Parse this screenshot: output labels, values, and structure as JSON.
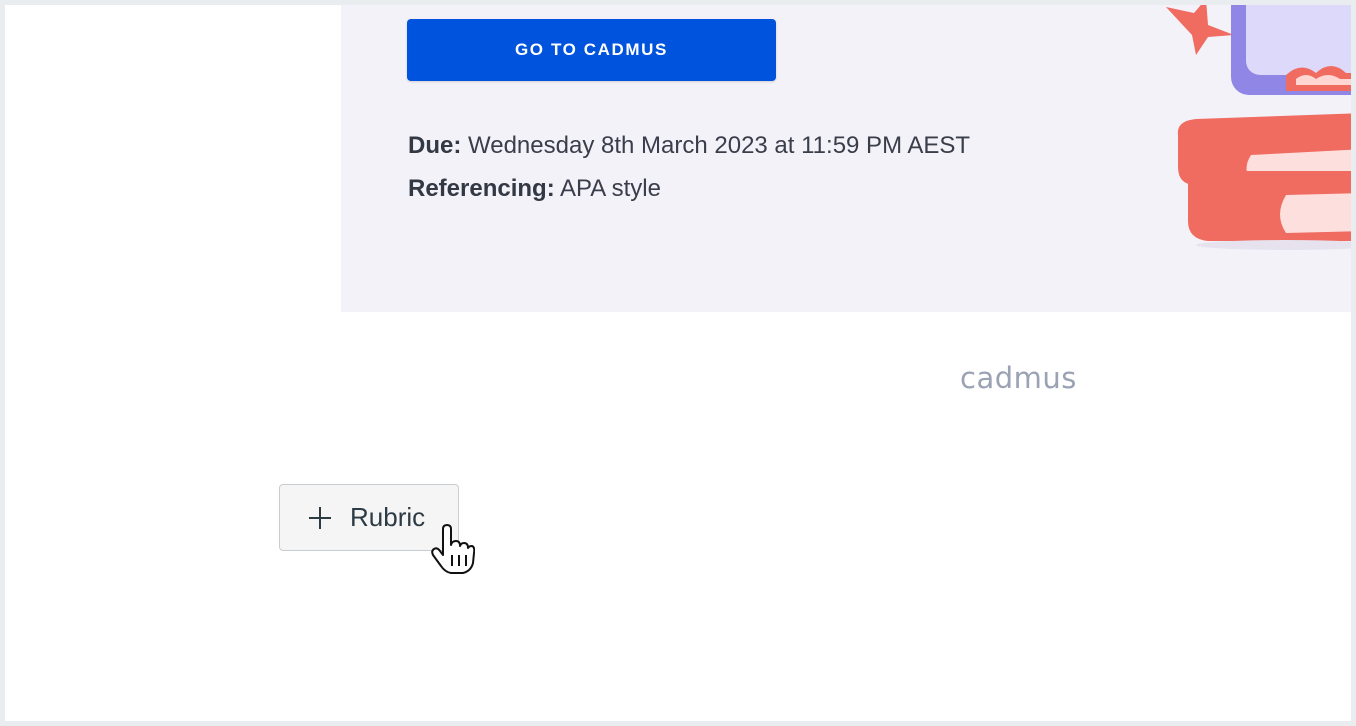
{
  "assignment": {
    "go_button_label": "GO TO CADMUS",
    "due_label": "Due:",
    "due_value": "Wednesday 8th March 2023 at 11:59 PM AEST",
    "referencing_label": "Referencing:",
    "referencing_value": "APA style"
  },
  "branding": {
    "logo_text": "cadmus"
  },
  "rubric": {
    "button_label": "Rubric"
  },
  "icons": {
    "illustration": "books-and-laptop-illustration",
    "plus": "plus-icon",
    "cursor": "hand-pointer-cursor-icon"
  },
  "colors": {
    "primary": "#0053dc",
    "card_background": "#f3f2f8",
    "logo": "#9aa2b4",
    "text": "#3a3d4a"
  }
}
